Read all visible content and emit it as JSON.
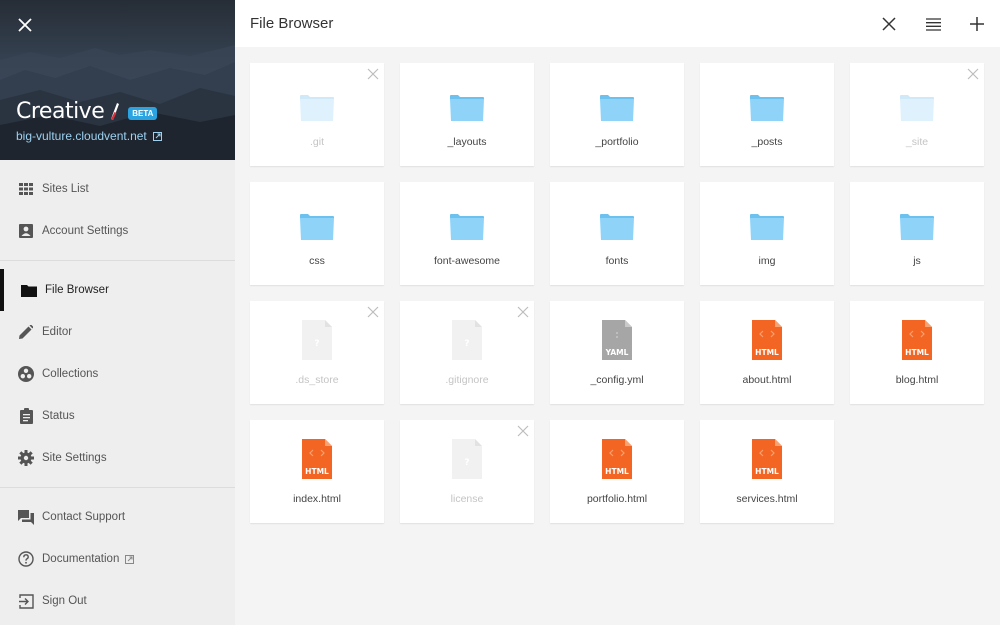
{
  "sidebar": {
    "site_title": "Creative",
    "beta_label": "BETA",
    "site_url": "big-vulture.cloudvent.net",
    "groups": [
      [
        {
          "label": "Sites List",
          "icon": "grid-icon"
        },
        {
          "label": "Account Settings",
          "icon": "account-icon"
        }
      ],
      [
        {
          "label": "File Browser",
          "icon": "folder-icon",
          "active": true
        },
        {
          "label": "Editor",
          "icon": "pencil-icon"
        },
        {
          "label": "Collections",
          "icon": "collections-icon"
        },
        {
          "label": "Status",
          "icon": "clipboard-icon"
        },
        {
          "label": "Site Settings",
          "icon": "gear-icon"
        }
      ],
      [
        {
          "label": "Contact Support",
          "icon": "chat-icon"
        },
        {
          "label": "Documentation",
          "icon": "help-icon",
          "external": true
        },
        {
          "label": "Sign Out",
          "icon": "sign-out-icon"
        }
      ]
    ]
  },
  "header": {
    "title": "File Browser",
    "actions": [
      "close",
      "list-view",
      "add"
    ]
  },
  "files": [
    {
      "name": ".git",
      "type": "folder",
      "hidden": true
    },
    {
      "name": "_layouts",
      "type": "folder",
      "hidden": false
    },
    {
      "name": "_portfolio",
      "type": "folder",
      "hidden": false
    },
    {
      "name": "_posts",
      "type": "folder",
      "hidden": false
    },
    {
      "name": "_site",
      "type": "folder",
      "hidden": true
    },
    {
      "name": "css",
      "type": "folder",
      "hidden": false
    },
    {
      "name": "font-awesome",
      "type": "folder",
      "hidden": false
    },
    {
      "name": "fonts",
      "type": "folder",
      "hidden": false
    },
    {
      "name": "img",
      "type": "folder",
      "hidden": false
    },
    {
      "name": "js",
      "type": "folder",
      "hidden": false
    },
    {
      "name": ".ds_store",
      "type": "unknown",
      "hidden": true
    },
    {
      "name": ".gitignore",
      "type": "unknown",
      "hidden": true
    },
    {
      "name": "_config.yml",
      "type": "yaml",
      "hidden": false,
      "badge": "YAML"
    },
    {
      "name": "about.html",
      "type": "html",
      "hidden": false,
      "badge": "HTML"
    },
    {
      "name": "blog.html",
      "type": "html",
      "hidden": false,
      "badge": "HTML"
    },
    {
      "name": "index.html",
      "type": "html",
      "hidden": false,
      "badge": "HTML"
    },
    {
      "name": "license",
      "type": "unknown",
      "hidden": true
    },
    {
      "name": "portfolio.html",
      "type": "html",
      "hidden": false,
      "badge": "HTML"
    },
    {
      "name": "services.html",
      "type": "html",
      "hidden": false,
      "badge": "HTML"
    }
  ],
  "colors": {
    "folder": "#8fd3f8",
    "folder_dim": "#dff1fc",
    "html": "#f26522",
    "yaml": "#a6a6a6",
    "beta": "#2aa3e0",
    "url": "#9dd1f0"
  }
}
